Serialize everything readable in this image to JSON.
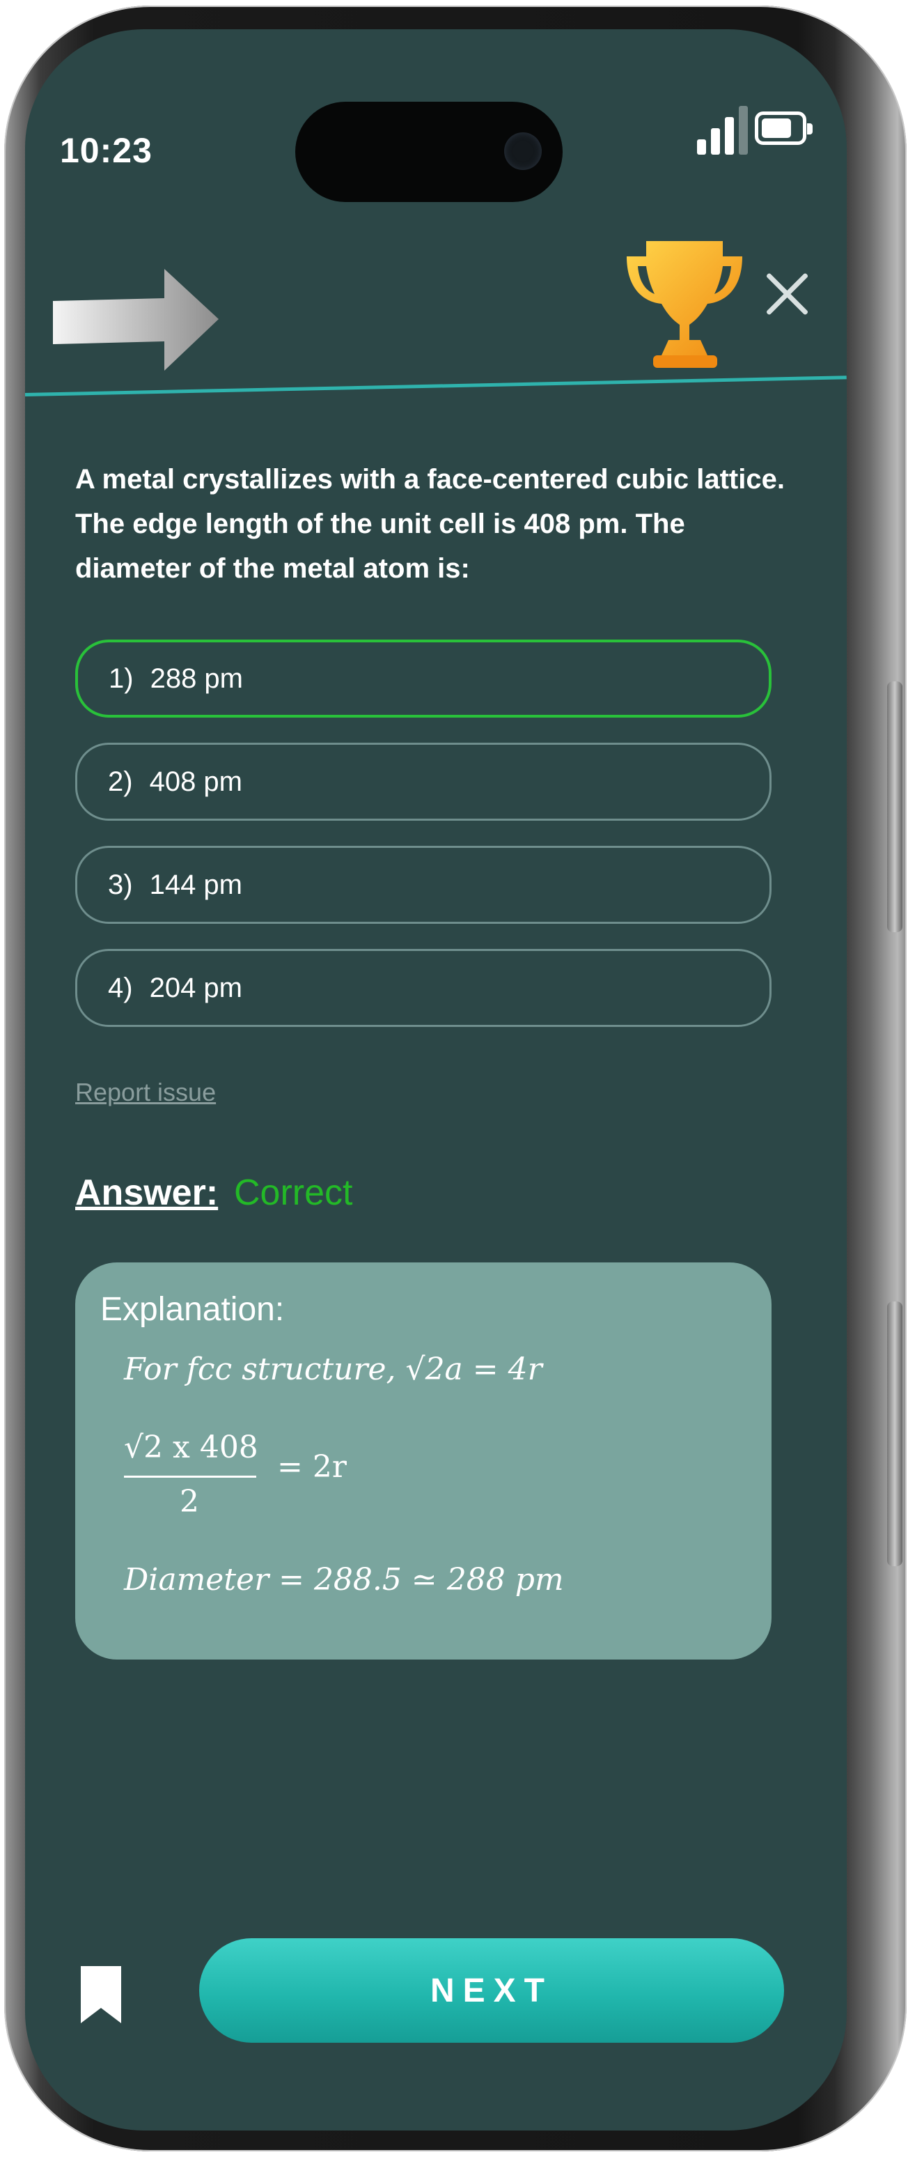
{
  "status_bar": {
    "time": "10:23"
  },
  "header": {
    "forward_icon": "arrow-right-icon",
    "trophy_icon": "trophy-icon",
    "close_icon": "close-icon"
  },
  "question": {
    "text": "A metal crystallizes with a face-centered cubic lattice. The edge length of the unit cell is 408 pm. The diameter of the metal atom is:"
  },
  "options": [
    {
      "number": "1)",
      "label": "288 pm",
      "state": "correct"
    },
    {
      "number": "2)",
      "label": "408 pm",
      "state": "default"
    },
    {
      "number": "3)",
      "label": "144 pm",
      "state": "default"
    },
    {
      "number": "4)",
      "label": "204 pm",
      "state": "default"
    }
  ],
  "report_link": "Report issue",
  "answer": {
    "label": "Answer:",
    "value": "Correct",
    "value_color": "#23b927"
  },
  "explanation": {
    "title": "Explanation:",
    "line1": "For fcc structure, √2a = 4r",
    "fraction_numerator": "√2 x 408",
    "fraction_denominator": "2",
    "fraction_rhs": "= 2r",
    "line3": "Diameter = 288.5 ≃ 288 pm"
  },
  "footer": {
    "bookmark_icon": "bookmark-icon",
    "next_label": "NEXT"
  },
  "colors": {
    "background": "#2c4747",
    "accent": "#2fb3ad",
    "correct_border": "#29c13a",
    "explanation_bg": "#7aa59e",
    "next_button": "#21b7ad"
  }
}
